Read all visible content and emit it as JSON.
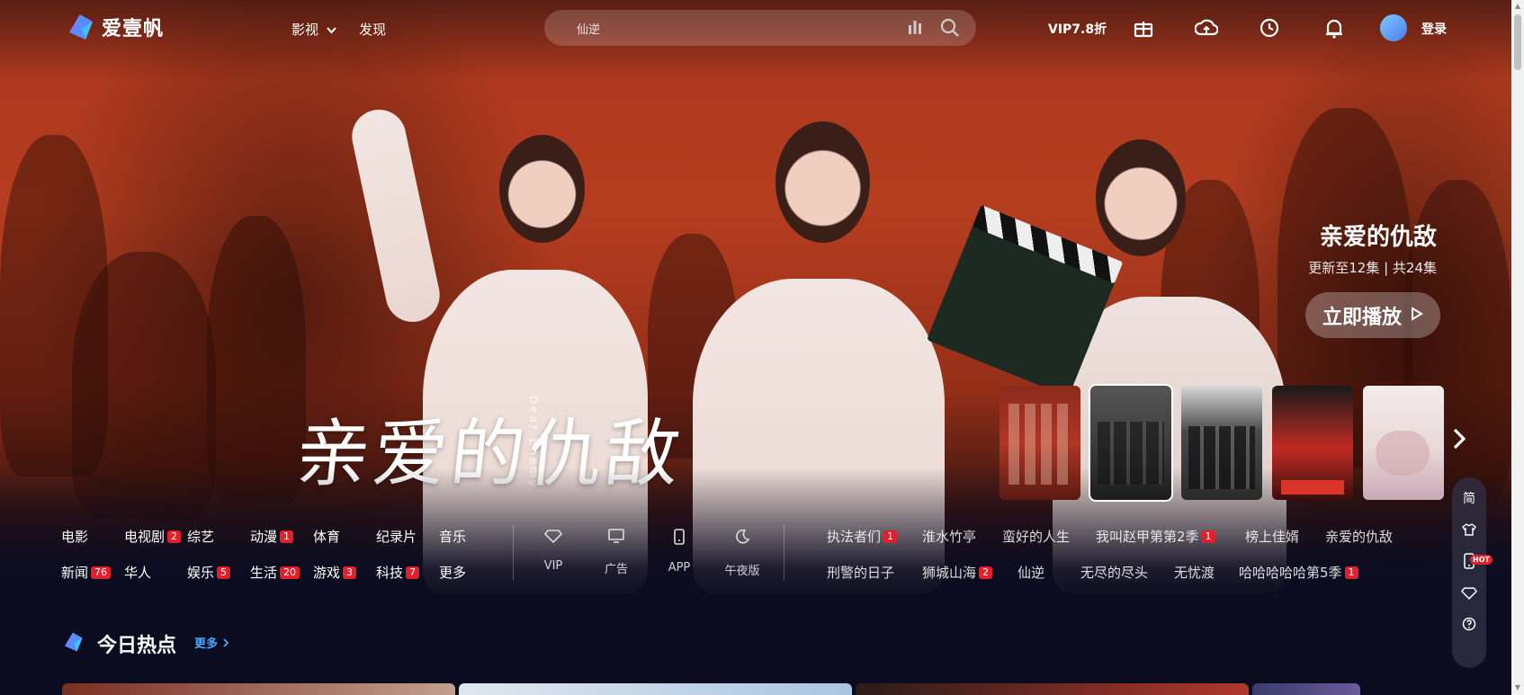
{
  "brand": {
    "name": "爱壹帆"
  },
  "nav": {
    "items": [
      {
        "label": "影视",
        "has_dropdown": true
      },
      {
        "label": "发现",
        "has_dropdown": false
      }
    ]
  },
  "search": {
    "query": "仙逆"
  },
  "header_actions": {
    "vip_discount": "VIP7.8折",
    "icons": [
      "gift-icon",
      "upload-cloud-icon",
      "history-icon",
      "bell-icon"
    ],
    "login_label": "登录"
  },
  "hero": {
    "title": "亲爱的仇敌",
    "calligraphy_title": "亲爱的仇敌",
    "calligraphy_subtitle": "Dear Enemy",
    "episode_info": "更新至12集 | 共24集",
    "play_label": "立即播放"
  },
  "thumbnails": {
    "count_visible": 5,
    "items": [
      {
        "accent": "#b03524"
      },
      {
        "accent": "#3d3d3f"
      },
      {
        "accent": "#4a4a4c"
      },
      {
        "accent": "#c02a22"
      },
      {
        "accent": "#e9d9d8"
      }
    ],
    "next_icon": "chevron-right-icon"
  },
  "categories": {
    "row1": [
      {
        "label": "电影",
        "badge": null
      },
      {
        "label": "电视剧",
        "badge": "2"
      },
      {
        "label": "综艺",
        "badge": null
      },
      {
        "label": "动漫",
        "badge": "1"
      },
      {
        "label": "体育",
        "badge": null
      },
      {
        "label": "纪录片",
        "badge": null
      },
      {
        "label": "音乐",
        "badge": null
      }
    ],
    "row2": [
      {
        "label": "新闻",
        "badge": "76"
      },
      {
        "label": "华人",
        "badge": null
      },
      {
        "label": "娱乐",
        "badge": "5"
      },
      {
        "label": "生活",
        "badge": "20"
      },
      {
        "label": "游戏",
        "badge": "3"
      },
      {
        "label": "科技",
        "badge": "7"
      },
      {
        "label": "更多",
        "badge": null
      }
    ]
  },
  "quick_links": [
    {
      "label": "VIP",
      "icon": "diamond-icon"
    },
    {
      "label": "广告",
      "icon": "monitor-icon"
    },
    {
      "label": "APP",
      "icon": "phone-icon"
    },
    {
      "label": "午夜版",
      "icon": "moon-icon"
    }
  ],
  "hot_searches": {
    "row1": [
      {
        "label": "执法者们",
        "badge": "1"
      },
      {
        "label": "淮水竹亭",
        "badge": null
      },
      {
        "label": "蛮好的人生",
        "badge": null
      },
      {
        "label": "我叫赵甲第第2季",
        "badge": "1"
      },
      {
        "label": "榜上佳婿",
        "badge": null
      },
      {
        "label": "亲爱的仇敌",
        "badge": null
      }
    ],
    "row2": [
      {
        "label": "刑警的日子",
        "badge": null
      },
      {
        "label": "狮城山海",
        "badge": "2"
      },
      {
        "label": "仙逆",
        "badge": null
      },
      {
        "label": "无尽的尽头",
        "badge": null
      },
      {
        "label": "无忧渡",
        "badge": null
      },
      {
        "label": "哈哈哈哈哈第5季",
        "badge": "1"
      }
    ]
  },
  "section": {
    "title": "今日热点",
    "more_label": "更多"
  },
  "side_tools": [
    {
      "label": "简",
      "icon": null
    },
    {
      "label": "",
      "icon": "shirt-icon"
    },
    {
      "label": "",
      "icon": "mobile-icon",
      "hot": "HOT"
    },
    {
      "label": "",
      "icon": "diamond-icon"
    },
    {
      "label": "",
      "icon": "help-icon"
    }
  ],
  "colors": {
    "accent_blue": "#4aa8ff",
    "badge_red": "#e0202a",
    "hero_red": "#b53d1f",
    "bg_dark": "#0c0c20"
  }
}
